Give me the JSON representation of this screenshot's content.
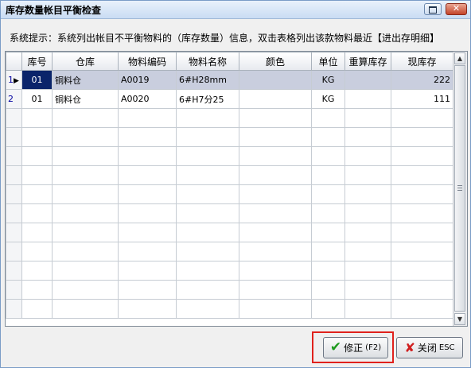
{
  "window": {
    "title": "库存数量帐目平衡检查",
    "close_glyph": "✕"
  },
  "hint_text": "系统提示：系统列出帐目不平衡物料的（库存数量）信息，双击表格列出该款物料最近【进出存明细】",
  "grid": {
    "columns": [
      "库号",
      "仓库",
      "物料编码",
      "物料名称",
      "颜色",
      "单位",
      "重算库存",
      "现库存"
    ],
    "rows": [
      {
        "index": "1",
        "cells": [
          "01",
          "铜料仓",
          "A0019",
          "6#H28mm",
          "",
          "KG",
          "",
          "222"
        ]
      },
      {
        "index": "2",
        "cells": [
          "01",
          "铜料仓",
          "A0020",
          "6#H7分25",
          "",
          "KG",
          "",
          "111"
        ]
      }
    ],
    "current_row_marker": "▶"
  },
  "buttons": {
    "fix_label": "修正",
    "fix_key": "(F2)",
    "close_label": "关闭",
    "close_key": "ESC"
  },
  "colors": {
    "selected_row": "#c9cede",
    "focus_cell": "#0a246a",
    "highlight_box": "#e0211c"
  }
}
